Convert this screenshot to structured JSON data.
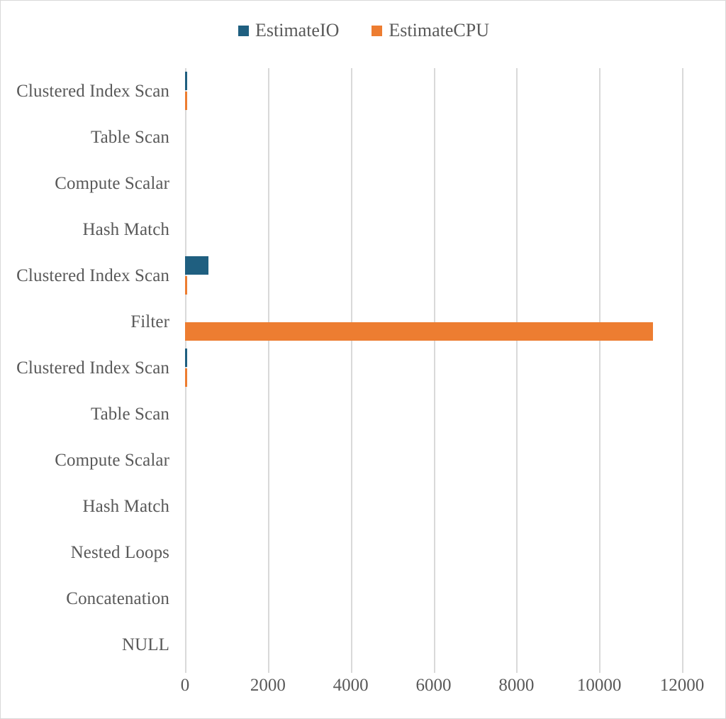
{
  "chart_data": {
    "type": "bar",
    "orientation": "horizontal",
    "title": "",
    "xlabel": "",
    "ylabel": "",
    "grid": true,
    "legend_position": "top",
    "xlim": [
      0,
      12000
    ],
    "xticks": [
      0,
      2000,
      4000,
      6000,
      8000,
      10000,
      12000
    ],
    "xtick_labels": [
      "0",
      "2000",
      "4000",
      "6000",
      "8000",
      "10000",
      "12000"
    ],
    "categories": [
      "Clustered Index Scan",
      "Table Scan",
      "Compute Scalar",
      "Hash Match",
      "Clustered Index Scan",
      "Filter",
      "Clustered Index Scan",
      "Table Scan",
      "Compute Scalar",
      "Hash Match",
      "Nested Loops",
      "Concatenation",
      "NULL"
    ],
    "series": [
      {
        "name": "EstimateIO",
        "color": "#1F5F80",
        "values": [
          52,
          0,
          0,
          0,
          565,
          0,
          52,
          0,
          0,
          0,
          0,
          0,
          0
        ]
      },
      {
        "name": "EstimateCPU",
        "color": "#ED7D31",
        "values": [
          2,
          0,
          0,
          0,
          6,
          11300,
          2,
          0,
          0,
          0,
          0,
          0,
          0
        ]
      }
    ]
  },
  "legend": {
    "items": [
      {
        "label": "EstimateIO",
        "color": "#1F5F80",
        "marker": "square-marker"
      },
      {
        "label": "EstimateCPU",
        "color": "#ED7D31",
        "marker": "square-marker"
      }
    ]
  },
  "colors": {
    "series_io": "#1F5F80",
    "series_cpu": "#ED7D31",
    "gridline": "#d9d9d9",
    "text": "#595959",
    "background": "#ffffff",
    "border": "#d9d9d9"
  }
}
